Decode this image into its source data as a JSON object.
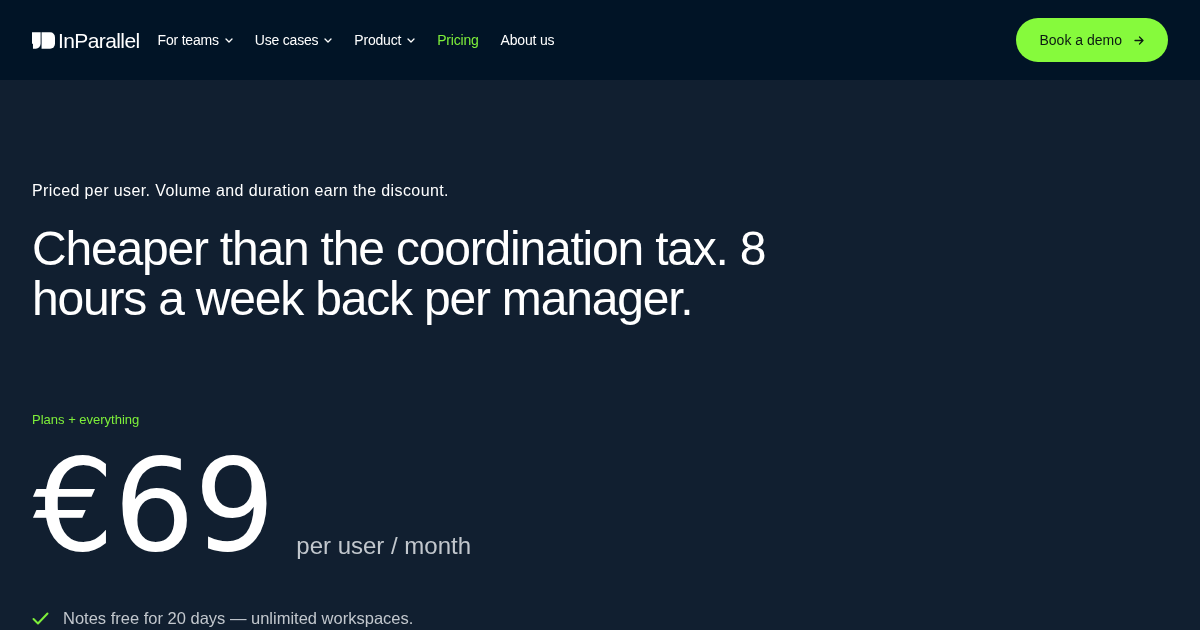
{
  "header": {
    "logo": {
      "text": "InParallel"
    },
    "nav": [
      {
        "label": "For teams",
        "dropdown": true,
        "selected": false
      },
      {
        "label": "Use cases",
        "dropdown": true,
        "selected": false
      },
      {
        "label": "Product",
        "dropdown": true,
        "selected": false
      },
      {
        "label": "Pricing",
        "dropdown": false,
        "selected": true
      },
      {
        "label": "About us",
        "dropdown": false,
        "selected": false
      }
    ],
    "cta": {
      "label": "Book a demo"
    }
  },
  "hero": {
    "eyebrow": "Priced per user. Volume and duration earn the discount.",
    "headline": "Cheaper than the coordination tax. 8 hours a week back per manager."
  },
  "plan": {
    "label": "Plans + everything",
    "price": "€69",
    "unit": "per user / month",
    "features": [
      {
        "text": "Notes free for 20 days — unlimited workspaces.",
        "included": true
      }
    ]
  }
}
